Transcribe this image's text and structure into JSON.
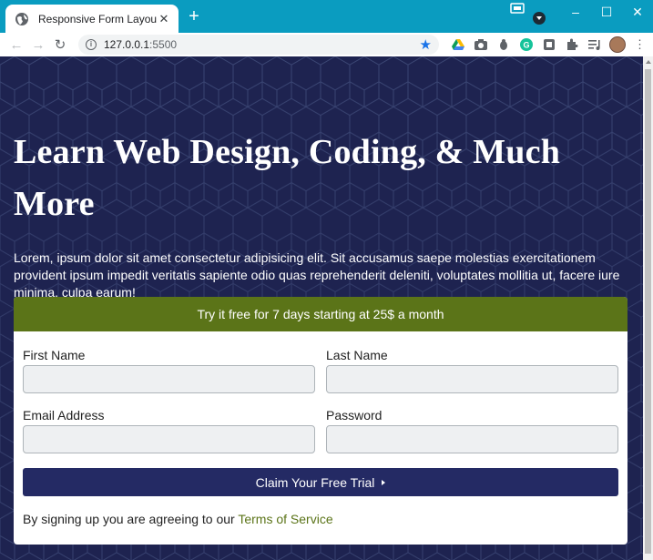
{
  "browser": {
    "tab_title": "Responsive Form Layout",
    "url_host": "127.0.0.1",
    "url_port": ":5500",
    "icons": [
      "back-icon",
      "forward-icon",
      "reload-icon",
      "info-icon",
      "star-icon",
      "drive-icon",
      "camera-icon",
      "bug-icon",
      "grammarly-icon",
      "extension-icon",
      "puzzle-icon",
      "media-icon",
      "avatar",
      "menu-icon"
    ]
  },
  "page": {
    "heading": "Learn Web Design, Coding, & Much More",
    "lead": "Lorem, ipsum dolor sit amet consectetur adipisicing elit. Sit accusamus saepe molestias exercitationem provident ipsum impedit veritatis sapiente odio quas reprehenderit deleniti, voluptates mollitia ut, facere iure minima, culpa earum!",
    "colors": {
      "background": "#1e2350",
      "accent_green": "#5b7418",
      "button_navy": "#242a64"
    }
  },
  "form": {
    "banner": "Try it free for 7 days starting at 25$ a month",
    "first_name_label": "First Name",
    "last_name_label": "Last Name",
    "email_label": "Email Address",
    "password_label": "Password",
    "first_name_value": "",
    "last_name_value": "",
    "email_value": "",
    "password_value": "",
    "submit_label": "Claim Your Free Trial",
    "terms_prefix": "By signing up you are agreeing to our ",
    "terms_link": "Terms of Service"
  }
}
